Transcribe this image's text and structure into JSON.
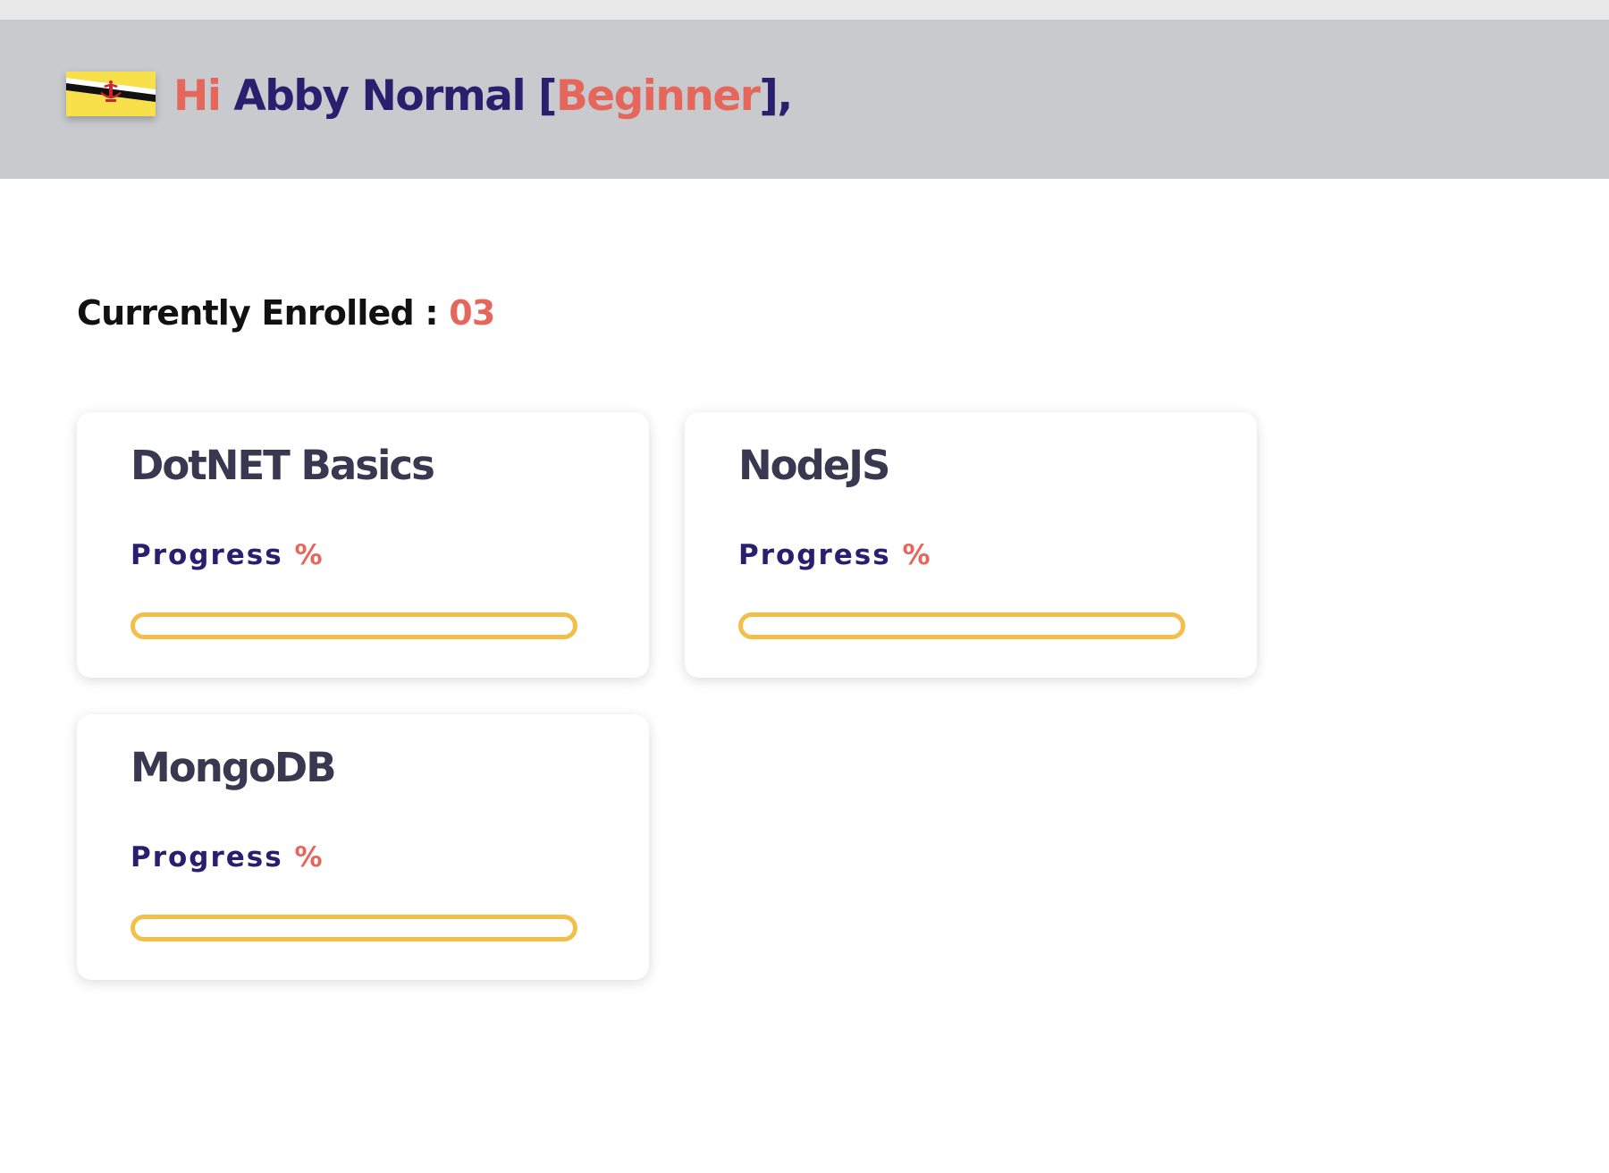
{
  "header": {
    "greeting_hi": "Hi",
    "user_name": "Abby Normal",
    "bracket_open": "[",
    "level": "Beginner",
    "bracket_close": "],",
    "flag_icon": "brunei-flag-icon"
  },
  "enrolled": {
    "label": "Currently Enrolled :",
    "count": "03"
  },
  "courses": [
    {
      "title": "DotNET Basics",
      "progress_label": "Progress",
      "progress_symbol": "%",
      "progress": 0
    },
    {
      "title": "NodeJS",
      "progress_label": "Progress",
      "progress_symbol": "%",
      "progress": 0
    },
    {
      "title": "MongoDB",
      "progress_label": "Progress",
      "progress_symbol": "%",
      "progress": 0
    }
  ],
  "colors": {
    "accent": "#e5675b",
    "primary": "#2a1f6e",
    "progress": "#f2c04a",
    "header_bg": "#c9cace",
    "title_text": "#3a3750"
  }
}
